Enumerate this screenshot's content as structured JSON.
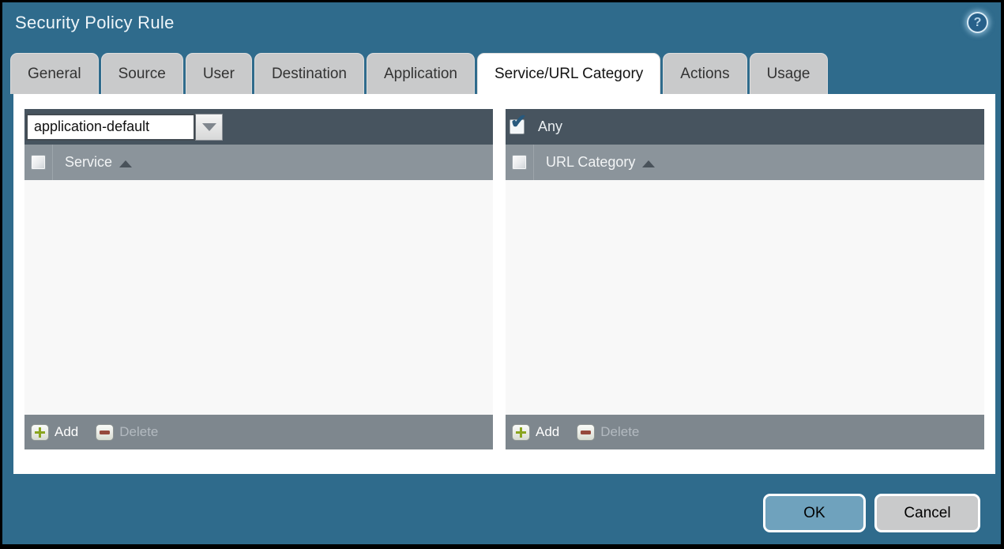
{
  "title_bar": {
    "title": "Security Policy Rule",
    "help_icon": "?"
  },
  "tabs": [
    {
      "label": "General",
      "active": false
    },
    {
      "label": "Source",
      "active": false
    },
    {
      "label": "User",
      "active": false
    },
    {
      "label": "Destination",
      "active": false
    },
    {
      "label": "Application",
      "active": false
    },
    {
      "label": "Service/URL Category",
      "active": true
    },
    {
      "label": "Actions",
      "active": false
    },
    {
      "label": "Usage",
      "active": false
    }
  ],
  "service_panel": {
    "service_type_value": "application-default",
    "column_header": "Service",
    "sort_order": "ascending",
    "header_checkbox_checked": false,
    "rows": [],
    "add_label": "Add",
    "delete_label": "Delete",
    "delete_enabled": false
  },
  "url_category_panel": {
    "any_label": "Any",
    "any_checked": true,
    "column_header": "URL Category",
    "sort_order": "ascending",
    "header_checkbox_checked": false,
    "rows": [],
    "add_label": "Add",
    "delete_label": "Delete",
    "delete_enabled": false
  },
  "action_buttons": {
    "ok_label": "OK",
    "cancel_label": "Cancel"
  },
  "icons": {
    "check": "✔"
  },
  "colors": {
    "dialog_teal": "#2f6b8c",
    "toolbar_slate": "#47545f",
    "grid_header_gray": "#8b949b",
    "footer_gray": "#7e878e",
    "ok_button_blue": "#6fa2bd",
    "cancel_button_gray": "#c9cacb",
    "add_plus_green": "#8aa51f",
    "delete_minus_red": "#96493c",
    "check_mark_blue": "#27597d"
  }
}
